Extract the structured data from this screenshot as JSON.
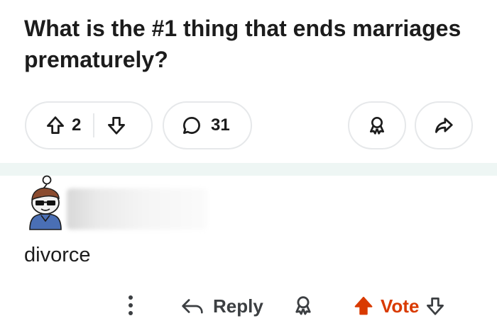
{
  "post": {
    "title": "What is the #1 thing that ends marriages prematurely?",
    "vote_count": "2",
    "comment_count": "31"
  },
  "comment": {
    "text": "divorce",
    "actions": {
      "reply_label": "Reply",
      "vote_label": "Vote"
    }
  },
  "colors": {
    "text": "#1c1c1c",
    "pill_border": "#e6e8ea",
    "upvote_active": "#d93a00",
    "divider_band": "#eef6f4"
  }
}
